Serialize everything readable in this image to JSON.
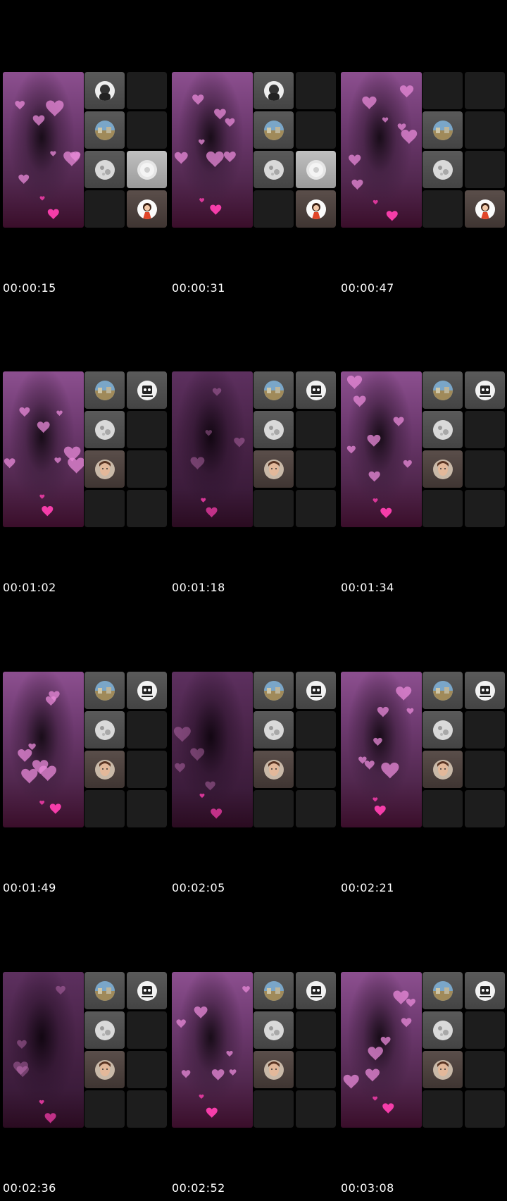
{
  "frames": [
    {
      "timestamp": "00:00:15",
      "variant": "A"
    },
    {
      "timestamp": "00:00:31",
      "variant": "A"
    },
    {
      "timestamp": "00:00:47",
      "variant": "B"
    },
    {
      "timestamp": "00:01:02",
      "variant": "C"
    },
    {
      "timestamp": "00:01:18",
      "variant": "C"
    },
    {
      "timestamp": "00:01:34",
      "variant": "C"
    },
    {
      "timestamp": "00:01:49",
      "variant": "C"
    },
    {
      "timestamp": "00:02:05",
      "variant": "C"
    },
    {
      "timestamp": "00:02:21",
      "variant": "C"
    },
    {
      "timestamp": "00:02:36",
      "variant": "C"
    },
    {
      "timestamp": "00:02:52",
      "variant": "C"
    },
    {
      "timestamp": "00:03:08",
      "variant": "C"
    }
  ],
  "variants": {
    "A": [
      "hooded-avatar",
      "empty",
      "landscape-avatar",
      "empty",
      "moon-avatar",
      "default-user-avatar",
      "empty",
      "cartoon-girl-avatar"
    ],
    "B": [
      "empty",
      "empty",
      "landscape-avatar",
      "empty",
      "moon-avatar",
      "empty",
      "empty",
      "cartoon-girl-avatar"
    ],
    "C": [
      "landscape-avatar",
      "robot-avatar",
      "moon-avatar",
      "empty",
      "portrait-avatar",
      "empty",
      "empty",
      "empty"
    ]
  },
  "colors": {
    "heart": "#ff3fb0",
    "heart_soft": "#e889d8",
    "background": "#000000"
  }
}
